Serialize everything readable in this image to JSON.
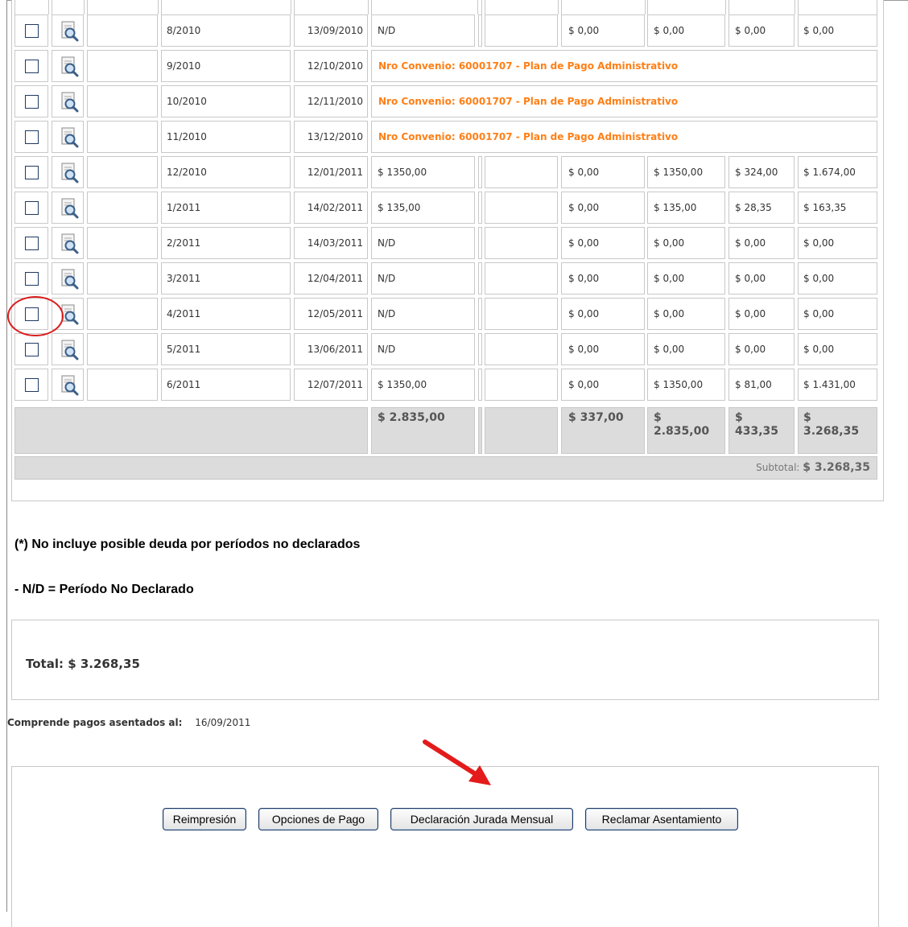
{
  "table": {
    "rows": [
      {
        "period": "8/2010",
        "due_date": "13/09/2010",
        "importe": "N/D",
        "v1": "$ 0,00",
        "v2": "$ 0,00",
        "v3": "$ 0,00",
        "v4": "$ 0,00"
      },
      {
        "period": "9/2010",
        "due_date": "12/10/2010",
        "note": "Nro Convenio: 60001707 - Plan de Pago Administrativo"
      },
      {
        "period": "10/2010",
        "due_date": "12/11/2010",
        "note": "Nro Convenio: 60001707 - Plan de Pago Administrativo"
      },
      {
        "period": "11/2010",
        "due_date": "13/12/2010",
        "note": "Nro Convenio: 60001707 - Plan de Pago Administrativo"
      },
      {
        "period": "12/2010",
        "due_date": "12/01/2011",
        "importe": "$ 1350,00",
        "v1": "$ 0,00",
        "v2": "$ 1350,00",
        "v3": "$ 324,00",
        "v4": "$ 1.674,00"
      },
      {
        "period": "1/2011",
        "due_date": "14/02/2011",
        "importe": "$ 135,00",
        "v1": "$ 0,00",
        "v2": "$ 135,00",
        "v3": "$ 28,35",
        "v4": "$ 163,35"
      },
      {
        "period": "2/2011",
        "due_date": "14/03/2011",
        "importe": "N/D",
        "v1": "$ 0,00",
        "v2": "$ 0,00",
        "v3": "$ 0,00",
        "v4": "$ 0,00"
      },
      {
        "period": "3/2011",
        "due_date": "12/04/2011",
        "importe": "N/D",
        "v1": "$ 0,00",
        "v2": "$ 0,00",
        "v3": "$ 0,00",
        "v4": "$ 0,00"
      },
      {
        "period": "4/2011",
        "due_date": "12/05/2011",
        "importe": "N/D",
        "v1": "$ 0,00",
        "v2": "$ 0,00",
        "v3": "$ 0,00",
        "v4": "$ 0,00"
      },
      {
        "period": "5/2011",
        "due_date": "13/06/2011",
        "importe": "N/D",
        "v1": "$ 0,00",
        "v2": "$ 0,00",
        "v3": "$ 0,00",
        "v4": "$ 0,00"
      },
      {
        "period": "6/2011",
        "due_date": "12/07/2011",
        "importe": "$ 1350,00",
        "v1": "$ 0,00",
        "v2": "$ 1350,00",
        "v3": "$ 81,00",
        "v4": "$ 1.431,00"
      }
    ],
    "totals": {
      "importe": "$ 2.835,00",
      "v1": "$ 337,00",
      "v2_line1": "$",
      "v2_line2": "2.835,00",
      "v3_line1": "$",
      "v3_line2": "433,35",
      "v4_line1": "$",
      "v4_line2": "3.268,35"
    },
    "subtotal_label": "Subtotal:",
    "subtotal_value": "$ 3.268,35"
  },
  "notes": {
    "no_incluye": "(*) No incluye posible deuda por períodos no declarados",
    "nd_legend": "- N/D = Período No Declarado"
  },
  "total": {
    "text": "Total: $ 3.268,35"
  },
  "pagos": {
    "label": "Comprende pagos asentados al:",
    "date": "16/09/2011"
  },
  "actions": {
    "reimpresion": "Reimpresión",
    "opciones_pago": "Opciones de Pago",
    "ddjj_mensual": "Declaración Jurada Mensual",
    "reclamar": "Reclamar Asentamiento"
  },
  "colors": {
    "note_orange": "#ff7f16",
    "annotation_red": "#d81e1e",
    "button_border": "#1a3a64"
  },
  "icons": {
    "row_detail": "magnifier-document-icon",
    "annotation_arrow": "red-arrow-icon"
  }
}
